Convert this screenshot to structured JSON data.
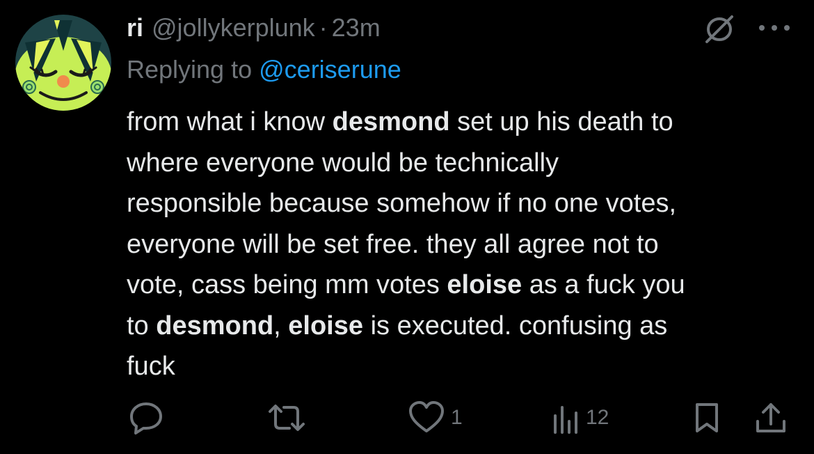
{
  "tweet": {
    "display_name": "ri",
    "handle": "@jollykerplunk",
    "separator": "·",
    "time": "23m",
    "replying_prefix": "Replying to",
    "replying_to": "@ceriserune",
    "body": {
      "l1_a": "from what i know ",
      "l1_b": "desmond",
      "l1_c": " set up his death to",
      "l2": "where everyone would be technically",
      "l3": "responsible because somehow if no one votes,",
      "l4": "everyone will be set free. they all agree not to",
      "l5_a": "vote, cass being mm votes ",
      "l5_b": "eloise",
      "l5_c": " as a fuck you",
      "l6_a": "to ",
      "l6_b": "desmond",
      "l6_c": ", ",
      "l6_d": "eloise",
      "l6_e": " is executed. confusing as",
      "l7": "fuck"
    }
  },
  "actions": {
    "likes": "1",
    "views": "12"
  },
  "icons": {
    "reply": "reply-icon",
    "retweet": "retweet-icon",
    "like": "heart-icon",
    "views": "views-icon",
    "bookmark": "bookmark-icon",
    "share": "share-icon",
    "hidden": "hidden-reply-icon",
    "more": "more-icon"
  },
  "colors": {
    "background": "#000000",
    "text": "#e7e9ea",
    "muted": "#71767b",
    "link": "#1d9bf0",
    "avatar_face": "#c6ee55"
  }
}
